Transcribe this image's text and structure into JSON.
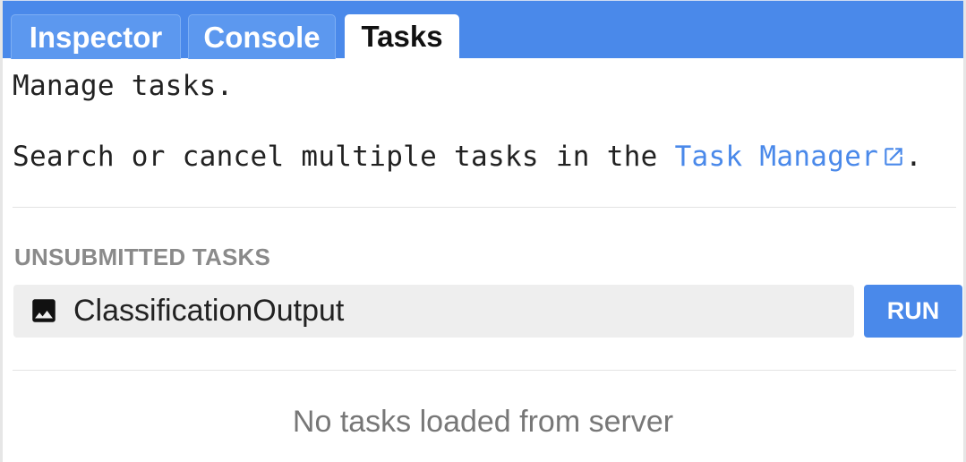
{
  "tabs": [
    {
      "label": "Inspector",
      "active": false
    },
    {
      "label": "Console",
      "active": false
    },
    {
      "label": "Tasks",
      "active": true
    }
  ],
  "intro": {
    "heading": "Manage tasks.",
    "search_prefix": "Search or cancel multiple tasks in the ",
    "link_text": "Task Manager",
    "link_icon": "open-in-new-icon",
    "search_suffix": "."
  },
  "unsubmitted": {
    "header": "UNSUBMITTED TASKS",
    "tasks": [
      {
        "icon": "image-icon",
        "name": "ClassificationOutput",
        "action_label": "RUN"
      }
    ]
  },
  "server_status": "No tasks loaded from server",
  "colors": {
    "accent": "#4a89ea",
    "tab_bar": "#4a89ea",
    "row_bg": "#eeeeee",
    "section_header": "#8a8a8a",
    "muted_text": "#777777"
  }
}
